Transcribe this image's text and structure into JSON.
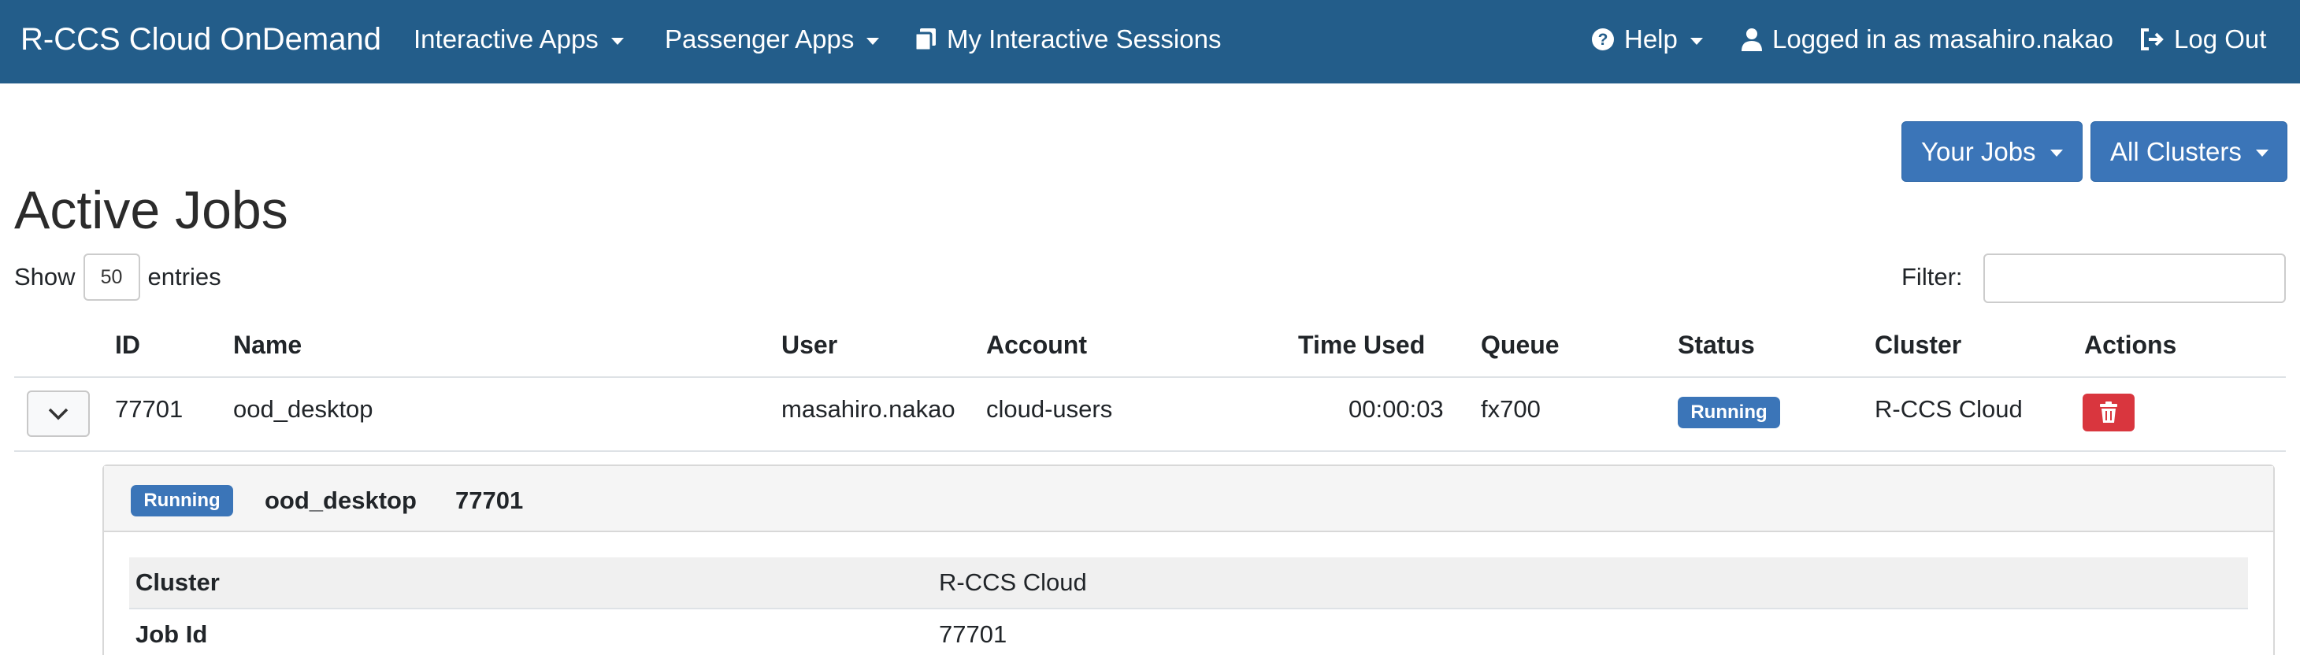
{
  "navbar": {
    "brand": "R-CCS Cloud OnDemand",
    "interactive_apps": "Interactive Apps",
    "passenger_apps": "Passenger Apps",
    "sessions": "My Interactive Sessions",
    "help": "Help",
    "logged_in": "Logged in as masahiro.nakao",
    "logout": "Log Out"
  },
  "filters": {
    "your_jobs": "Your Jobs",
    "all_clusters": "All Clusters"
  },
  "page_title": "Active Jobs",
  "entries": {
    "show": "Show",
    "value": "50",
    "entries": "entries"
  },
  "filter_label": "Filter:",
  "table": {
    "headers": {
      "id": "ID",
      "name": "Name",
      "user": "User",
      "account": "Account",
      "time_used": "Time Used",
      "queue": "Queue",
      "status": "Status",
      "cluster": "Cluster",
      "actions": "Actions"
    },
    "rows": [
      {
        "id": "77701",
        "name": "ood_desktop",
        "user": "masahiro.nakao",
        "account": "cloud-users",
        "time_used": "00:00:03",
        "queue": "fx700",
        "status": "Running",
        "cluster": "R-CCS Cloud"
      }
    ]
  },
  "detail": {
    "status": "Running",
    "name": "ood_desktop",
    "id": "77701",
    "rows": [
      {
        "label": "Cluster",
        "value": "R-CCS Cloud"
      },
      {
        "label": "Job Id",
        "value": "77701"
      }
    ]
  },
  "colors": {
    "navbar": "#235d8a",
    "primary_button": "#3b75b8",
    "badge": "#3b75b8",
    "danger": "#d9363e"
  }
}
